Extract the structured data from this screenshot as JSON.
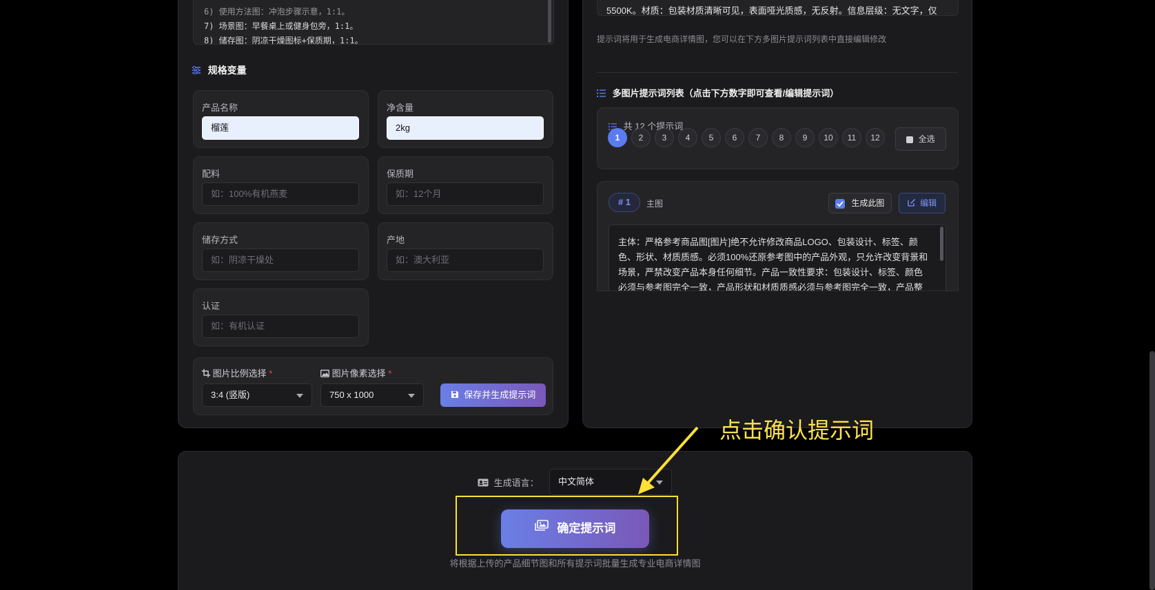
{
  "prompt_lines": [
    "7) 场景图：早餐桌上或健身包旁，1:1。",
    "8) 储存图：阴凉干燥图标+保质期，1:1。"
  ],
  "spec_section": {
    "title": "规格变量"
  },
  "fields": {
    "product_name": {
      "label": "产品名称",
      "value": "榴莲"
    },
    "net_content": {
      "label": "净含量",
      "value": "2kg"
    },
    "ingredients": {
      "label": "配料",
      "placeholder": "如：100%有机燕麦"
    },
    "shelf_life": {
      "label": "保质期",
      "placeholder": "如：12个月"
    },
    "storage": {
      "label": "储存方式",
      "placeholder": "如：阴凉干燥处"
    },
    "origin": {
      "label": "产地",
      "placeholder": "如：澳大利亚"
    },
    "certification": {
      "label": "认证",
      "placeholder": "如：有机认证"
    }
  },
  "image_settings": {
    "ratio_label": "图片比例选择",
    "ratio_value": "3:4 (竖版)",
    "pixel_label": "图片像素选择",
    "pixel_value": "750 x 1000",
    "required_mark": "*",
    "save_button": "保存并生成提示词"
  },
  "right": {
    "top_text": "5500K。材质：包装材质清晰可见，表面哑光质感，无反射。信息层级：无文字，仅",
    "hint": "提示词将用于生成电商详情图，您可以在下方多图片提示词列表中直接编辑修改",
    "list_title": "多图片提示词列表（点击下方数字即可查看/编辑提示词）",
    "count_text": "共 12 个提示词",
    "numbers": [
      "1",
      "2",
      "3",
      "4",
      "5",
      "6",
      "7",
      "8",
      "9",
      "10",
      "11",
      "12"
    ],
    "select_all": "全选",
    "detail": {
      "badge": "# 1",
      "type": "主图",
      "generate_label": "生成此图",
      "edit_label": "编辑",
      "text_lines": [
        "主体：严格参考商品图[图片]绝不允许修改商品LOGO、包装设计、标签、颜",
        "色、形状、材质质感。必须100%还原参考图中的产品外观，只允许改变背景和",
        "场景，严禁改变产品本身任何细节。产品一致性要求：包装设计、标签、颜色",
        "必须与参考图完全一致，产品形状和材质质感必须与参考图完全一致，产品整"
      ]
    }
  },
  "bottom": {
    "lang_label": "生成语言：",
    "lang_value": "中文简体",
    "confirm_button": "确定提示词",
    "footnote": "将根据上传的产品细节图和所有提示词批量生成专业电商详情图"
  },
  "annotation": {
    "text": "点击确认提示词",
    "color": "#ffe34d"
  },
  "colors": {
    "accent": "#5b7cf0",
    "gradient_start": "#6a7fe6",
    "gradient_end": "#7a58b8",
    "required": "#e5484d"
  }
}
